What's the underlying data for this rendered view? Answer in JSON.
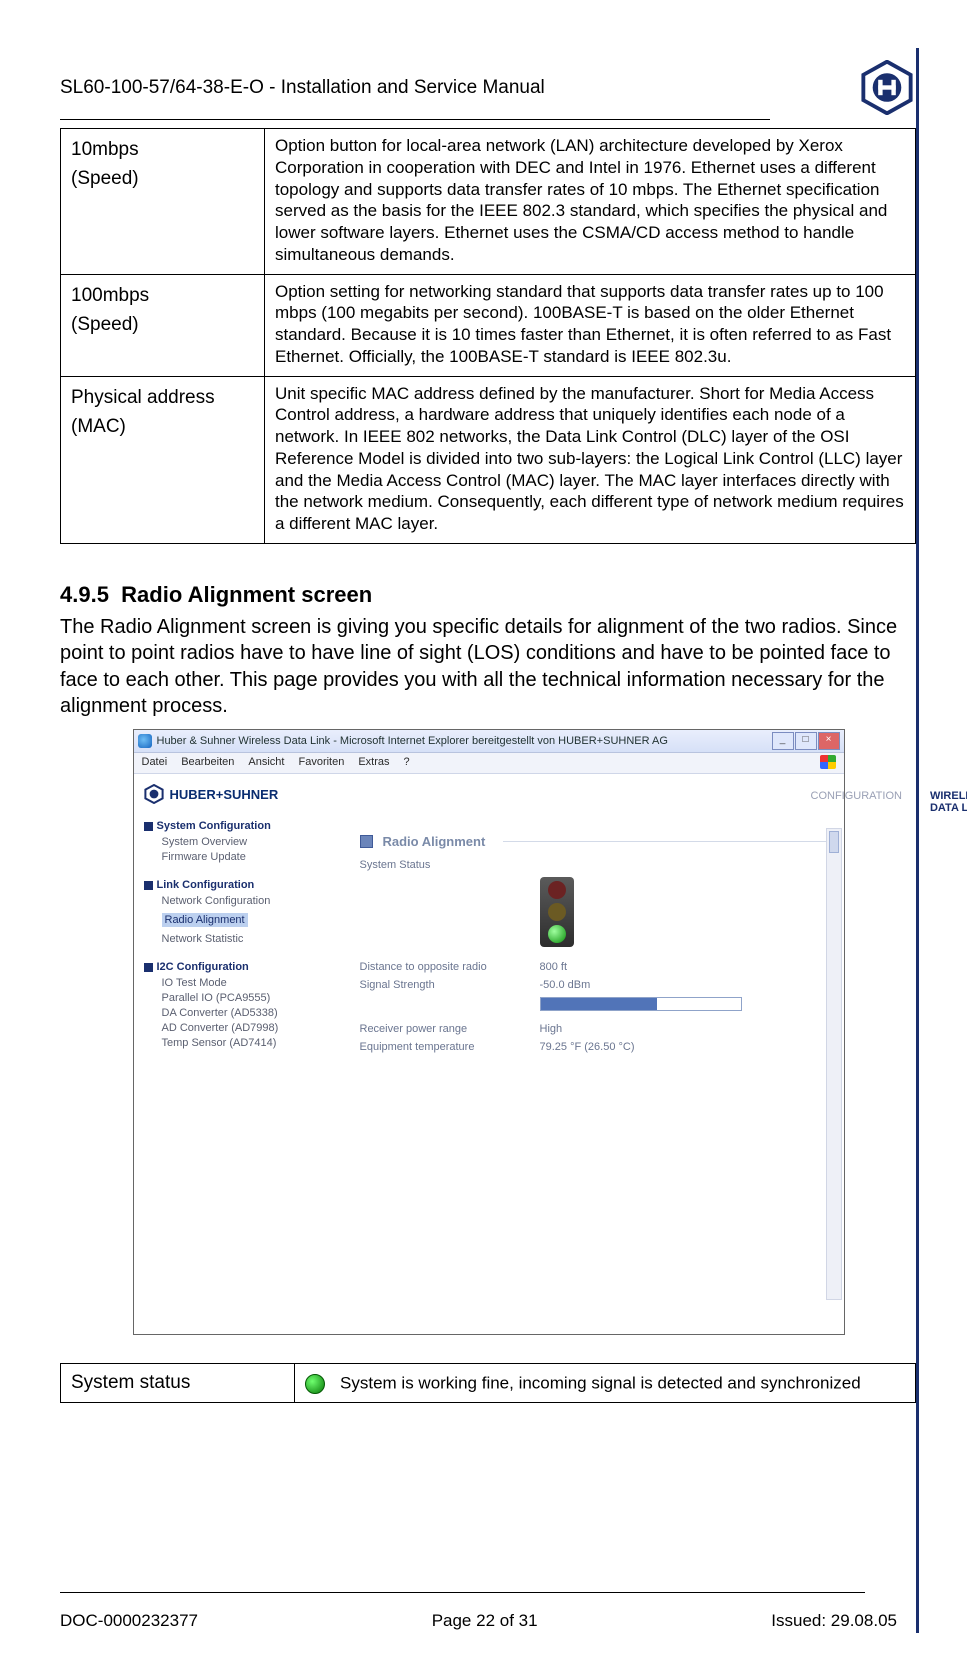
{
  "header": {
    "title": "SL60-100-57/64-38-E-O  -  Installation and Service Manual"
  },
  "def_table": [
    {
      "term_line1": "10mbps",
      "term_line2": "(Speed)",
      "desc": "Option button for local-area network (LAN) architecture developed by Xerox Corporation in cooperation with DEC and Intel in 1976. Ethernet uses a different topology and supports data transfer rates of 10 mbps. The Ethernet specification served as the basis for the IEEE 802.3 standard, which specifies the physical and lower software layers. Ethernet uses the CSMA/CD access method to handle simultaneous demands."
    },
    {
      "term_line1": "100mbps",
      "term_line2": "(Speed)",
      "desc": "Option setting for networking standard that supports data transfer rates up to 100 mbps (100 megabits per second). 100BASE-T is based on the older Ethernet standard. Because it is 10 times faster than Ethernet, it is often referred to as Fast Ethernet. Officially, the 100BASE-T standard is IEEE 802.3u."
    },
    {
      "term_line1": "Physical address (MAC)",
      "term_line2": "",
      "desc": "Unit specific MAC address defined by the manufacturer. Short for Media Access Control address, a hardware address that uniquely identifies each node of a network. In IEEE 802 networks, the Data Link Control (DLC) layer of the OSI Reference Model is divided into two sub-layers: the Logical Link Control (LLC) layer and the Media Access Control (MAC) layer. The MAC layer interfaces directly with the network medium. Consequently, each different type of network medium requires a different MAC layer."
    }
  ],
  "section": {
    "number": "4.9.5",
    "title": "Radio Alignment screen",
    "body": "The Radio Alignment screen is giving you specific details for alignment of the two radios. Since point to point radios have to have line of sight (LOS) conditions and have to be pointed face to face to each other. This page provides you with all the technical information necessary for the alignment process."
  },
  "screenshot": {
    "window_title": "Huber & Suhner Wireless Data Link - Microsoft Internet Explorer bereitgestellt von HUBER+SUHNER AG",
    "menus": [
      "Datei",
      "Bearbeiten",
      "Ansicht",
      "Favoriten",
      "Extras",
      "?"
    ],
    "brand": "HUBER+SUHNER",
    "top_tabs": {
      "inactive": "CONFIGURATION",
      "active": "WIRELESS DATA LINK"
    },
    "nav": {
      "groups": [
        {
          "title": "System Configuration",
          "items": [
            "System Overview",
            "Firmware Update"
          ]
        },
        {
          "title": "Link Configuration",
          "items": [
            "Network Configuration",
            "Radio Alignment",
            "Network Statistic"
          ],
          "selected_index": 1
        },
        {
          "title": "I2C Configuration",
          "items": [
            "IO Test Mode",
            "Parallel IO (PCA9555)",
            "DA Converter (AD5338)",
            "AD Converter (AD7998)",
            "Temp Sensor (AD7414)"
          ]
        }
      ]
    },
    "panel": {
      "title": "Radio Alignment",
      "rows": {
        "system_status_label": "System Status",
        "distance_label": "Distance to opposite radio",
        "distance_value": "800 ft",
        "signal_label": "Signal Strength",
        "signal_value": "-50.0 dBm",
        "receiver_label": "Receiver power range",
        "receiver_value": "High",
        "temp_label": "Equipment temperature",
        "temp_value": "79.25 °F   (26.50 °C)"
      }
    }
  },
  "status_table": {
    "term": "System status",
    "desc": "System is working fine, incoming signal is detected and synchronized"
  },
  "footer": {
    "left": "DOC-0000232377",
    "center": "Page 22 of 31",
    "right": "Issued: 29.08.05"
  }
}
